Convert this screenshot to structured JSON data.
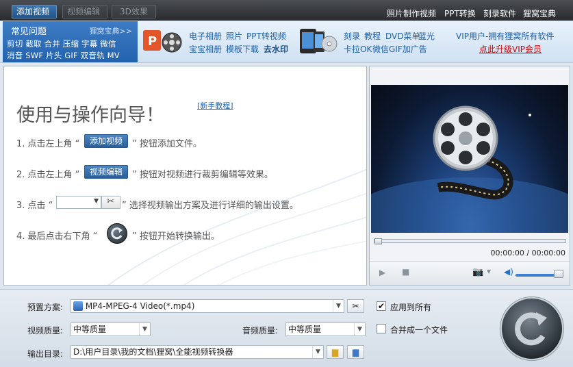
{
  "toolbar": {
    "add_video": "添加视频",
    "video_edit": "视频编辑",
    "effect_3d": "3D效果",
    "links": [
      "照片制作视频",
      "PPT转换",
      "刻录软件",
      "狸窝宝典"
    ]
  },
  "faq": {
    "title": "常见问题",
    "more": "狸窝宝典>>",
    "row1": "剪切 截取 合并 压缩 字幕 微信",
    "row2": "消音 SWF 片头 GIF 双音轨 MV"
  },
  "promo": {
    "a1": "电子相册",
    "a2": "照片",
    "a3": "PPT转视频",
    "b1": "宝宝相册",
    "b2": "模板下载",
    "b3": "去水印",
    "c1": "刻录",
    "c2": "教程",
    "c3": "DVD菜单",
    "c4": "蓝光",
    "d1": "卡拉OK",
    "d2": "微信GIF加广告",
    "vip_line": "VIP用户-拥有狸窝所有软件",
    "vip_upgrade": "点此升级VIP会员"
  },
  "guide": {
    "title": "使用与操作向导！",
    "tutorial": "[新手教程]",
    "step1_pre": "1. 点击左上角 “",
    "step1_btn": "添加视频",
    "step1_post": "” 按钮添加文件。",
    "step2_pre": "2. 点击左上角 “",
    "step2_btn": "视频编辑",
    "step2_post": "” 按钮对视频进行裁剪编辑等效果。",
    "step3_pre": "3. 点击 “",
    "step3_post": "” 选择视频输出方案及进行详细的输出设置。",
    "step4_pre": "4. 最后点击右下角 “",
    "step4_post": "” 按钮开始转换输出。"
  },
  "player": {
    "time": "00:00:00 / 00:00:00",
    "seek_fraction": 0.0,
    "volume_fraction": 1.0
  },
  "settings": {
    "preset_label": "预置方案:",
    "preset_value": "MP4-MPEG-4 Video(*.mp4)",
    "video_quality_label": "视频质量:",
    "video_quality_value": "中等质量",
    "audio_quality_label": "音频质量:",
    "audio_quality_value": "中等质量",
    "output_dir_label": "输出目录:",
    "output_dir_value": "D:\\用户目录\\我的文档\\狸窝\\全能视频转换器",
    "apply_all_label": "应用到所有",
    "apply_all_checked": true,
    "merge_label": "合并成一个文件",
    "merge_checked": false
  },
  "colors": {
    "accent": "#2a64a8",
    "link": "#1c5fa7",
    "vip_red": "#d40000"
  }
}
